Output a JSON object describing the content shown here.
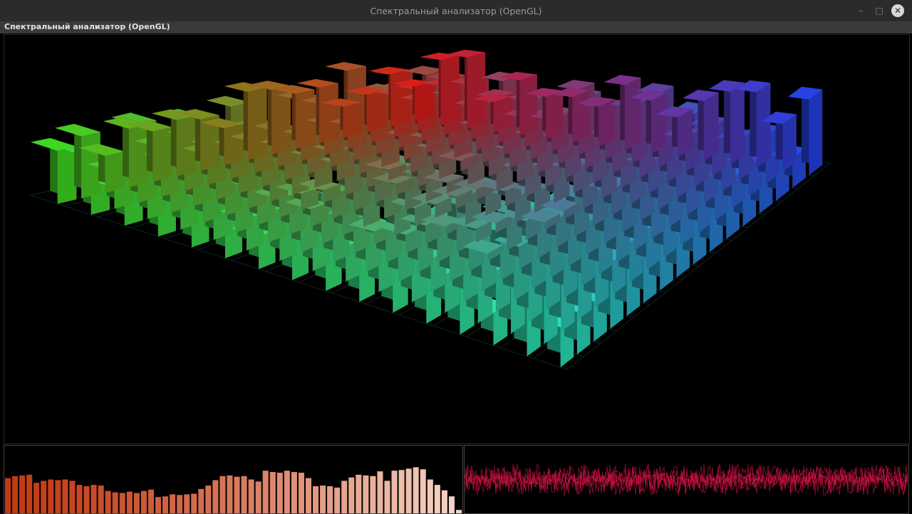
{
  "window": {
    "title": "Спектральный анализатор (OpenGL)",
    "minimize_icon": "minimize-icon",
    "maximize_icon": "maximize-icon",
    "close_icon": "close-icon",
    "minimize_glyph": "–",
    "maximize_glyph": "□",
    "close_glyph": "✕"
  },
  "panel": {
    "caption": "Спектральный анализатор (OpenGL)"
  },
  "colors": {
    "titlebar": "#2b2b2b",
    "bars_base": "#c23a14",
    "bars_light": "#f6d6c8",
    "waveform": "#e0144c",
    "grid": "#1a4a44"
  },
  "spectrum_bars": [
    0.52,
    0.55,
    0.56,
    0.57,
    0.45,
    0.48,
    0.5,
    0.49,
    0.5,
    0.48,
    0.42,
    0.4,
    0.42,
    0.41,
    0.33,
    0.31,
    0.3,
    0.32,
    0.3,
    0.33,
    0.35,
    0.24,
    0.25,
    0.28,
    0.27,
    0.28,
    0.29,
    0.36,
    0.41,
    0.49,
    0.55,
    0.56,
    0.54,
    0.55,
    0.5,
    0.47,
    0.63,
    0.61,
    0.6,
    0.63,
    0.61,
    0.6,
    0.52,
    0.4,
    0.41,
    0.4,
    0.38,
    0.48,
    0.53,
    0.57,
    0.56,
    0.55,
    0.62,
    0.48,
    0.63,
    0.64,
    0.66,
    0.68,
    0.65,
    0.5,
    0.42,
    0.34,
    0.25,
    0.05
  ],
  "waveform": {
    "traces": 6,
    "amplitude": 0.3
  }
}
